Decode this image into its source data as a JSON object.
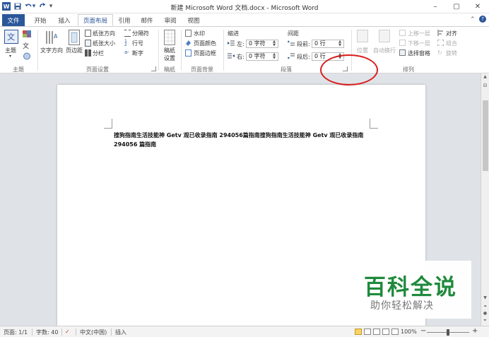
{
  "window": {
    "title": "新建 Microsoft Word 文档.docx - Microsoft Word",
    "app_icon": "W",
    "minimize": "–",
    "restore": "▢",
    "close": "✕"
  },
  "qat": {
    "save": "save-icon",
    "undo": "undo-icon",
    "redo": "redo-icon",
    "customize": "▾"
  },
  "tabs": [
    {
      "label": "文件"
    },
    {
      "label": "开始"
    },
    {
      "label": "插入"
    },
    {
      "label": "页面布局"
    },
    {
      "label": "引用"
    },
    {
      "label": "邮件"
    },
    {
      "label": "审阅"
    },
    {
      "label": "视图"
    }
  ],
  "ribbon": {
    "theme": {
      "themes_label": "主题",
      "group_label": "主题"
    },
    "page_setup": {
      "text_direction": "文字方向",
      "margins": "页边距",
      "orientation": "纸张方向",
      "size": "纸张大小",
      "columns": "分栏",
      "breaks": "分隔符",
      "line_numbers": "行号",
      "hyphenation": "断字",
      "group_label": "页面设置"
    },
    "manuscript": {
      "setup_line1": "稿纸",
      "setup_line2": "设置",
      "group_label": "稿纸"
    },
    "page_background": {
      "watermark": "水印",
      "page_color": "页面颜色",
      "page_borders": "页面边框",
      "group_label": "页面背景"
    },
    "paragraph": {
      "indent_title": "缩进",
      "left_label": "左:",
      "right_label": "右:",
      "indent_left_value": "0 字符",
      "indent_right_value": "0 字符",
      "spacing_title": "间距",
      "before_label": "段前:",
      "after_label": "段后:",
      "spacing_before_value": "0 行",
      "spacing_after_value": "0 行",
      "group_label": "段落"
    },
    "arrange": {
      "position": "位置",
      "wrap_text": "自动换行",
      "bring_forward": "上移一层",
      "send_backward": "下移一层",
      "selection_pane": "选择窗格",
      "align": "对齐",
      "group": "组合",
      "rotate": "旋转",
      "group_label": "排列"
    }
  },
  "document": {
    "body": "搜狗指南生活技能神  Getv  观已收录指南 294056篇指南搜狗指南生活技能神  Getv  观已收录指南 294056 篇指南"
  },
  "watermark_overlay": {
    "title": "百科全说",
    "subtitle": "助你轻松解决"
  },
  "statusbar": {
    "page": "页面: 1/1",
    "words": "字数: 40",
    "language": "中文(中国)",
    "mode": "插入",
    "zoom": "100%",
    "zoom_out": "−",
    "zoom_in": "+"
  },
  "colors": {
    "accent": "#2b579a",
    "annotation": "#d71e1e",
    "watermark_green": "#1f8a3c"
  }
}
